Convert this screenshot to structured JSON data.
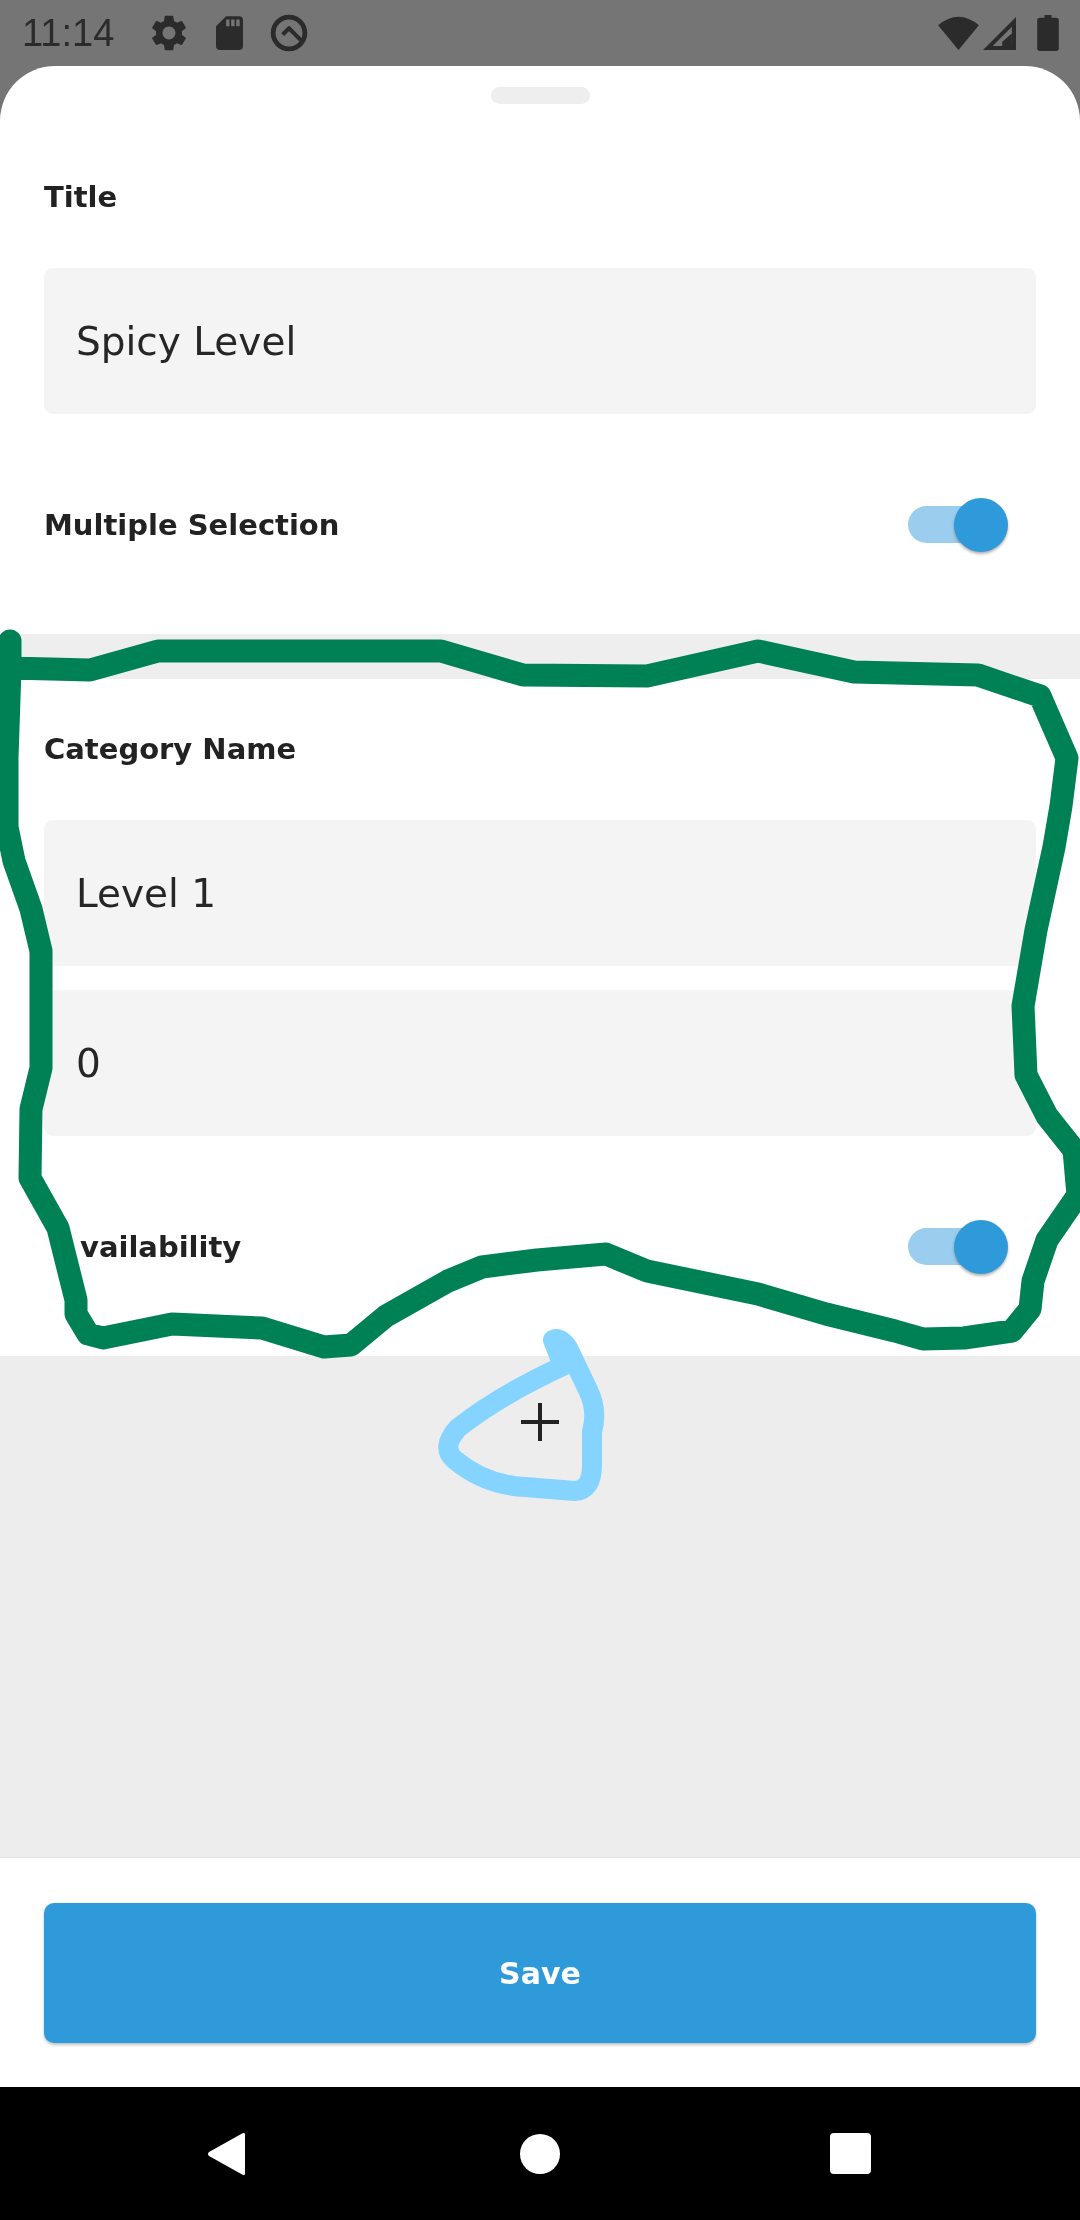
{
  "status_bar": {
    "time": "11:14"
  },
  "title_section": {
    "label": "Title",
    "field": {
      "value": "Spicy Level"
    },
    "switch": {
      "label": "Multiple Selection",
      "on": true
    }
  },
  "categories": [
    {
      "label": "Category Name",
      "fields": [
        {
          "value": "Level 1"
        },
        {
          "value": "0"
        }
      ],
      "switch": {
        "label": "vailability",
        "on": true
      }
    }
  ],
  "save_button": {
    "label": "Save"
  }
}
